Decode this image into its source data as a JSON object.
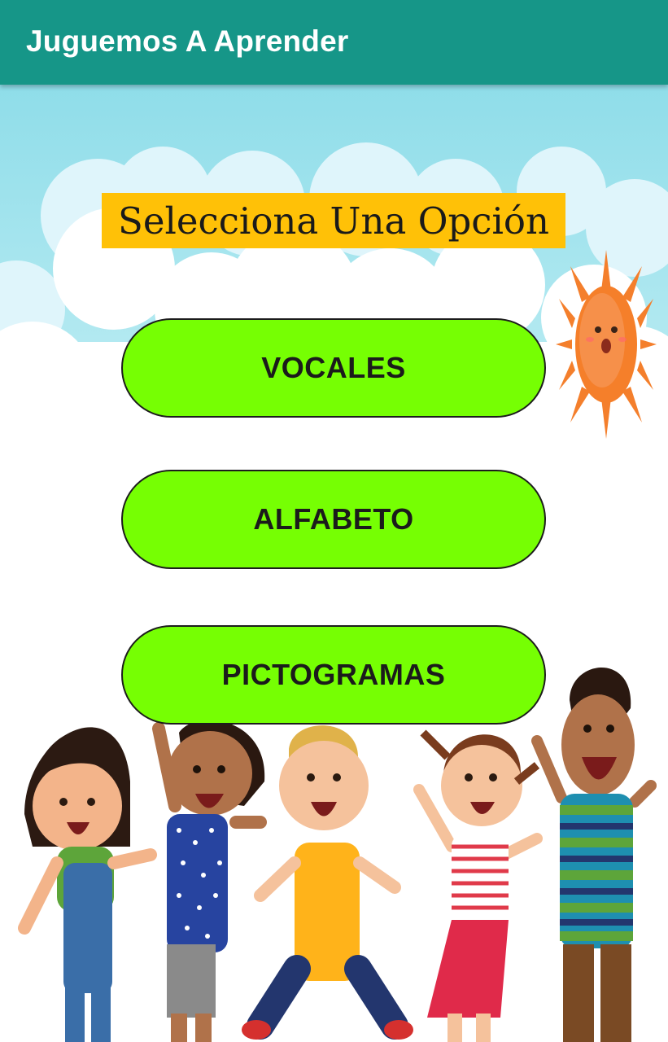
{
  "app_bar": {
    "title": "Juguemos A Aprender"
  },
  "main": {
    "heading": "Selecciona Una Opción",
    "options": [
      {
        "label": "VOCALES"
      },
      {
        "label": "ALFABETO"
      },
      {
        "label": "PICTOGRAMAS"
      }
    ]
  },
  "colors": {
    "app_bar": "#169688",
    "heading_bg": "#ffc107",
    "button_bg": "#76ff03",
    "sky": "#9fe3ef",
    "sun": "#f47f2c"
  },
  "illustration": {
    "icons": [
      "cloud-icon",
      "sun-icon",
      "children-illustration"
    ]
  }
}
